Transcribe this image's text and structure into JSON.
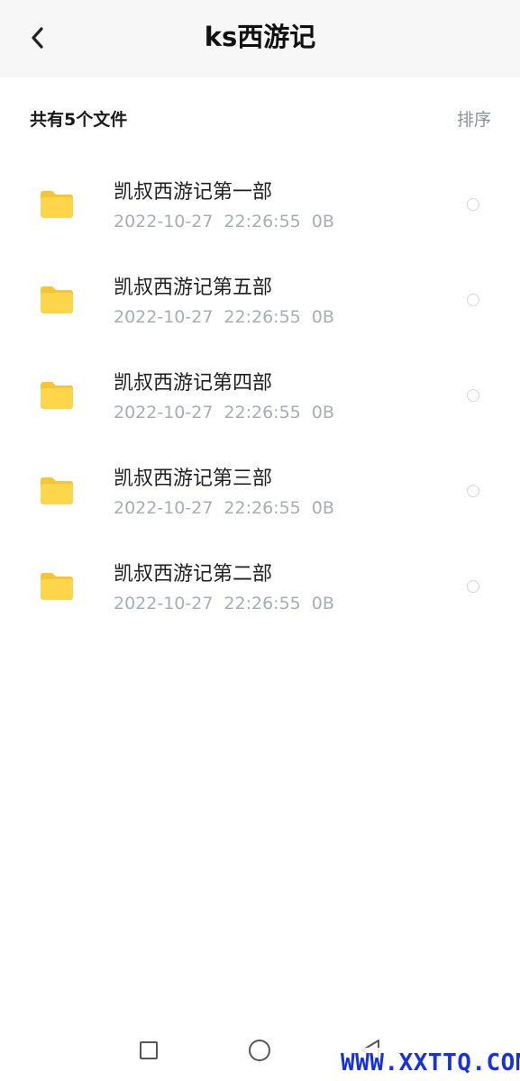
{
  "header": {
    "title": "ks西游记",
    "back_icon": "chevron-left-icon"
  },
  "summary": {
    "count_label": "共有5个文件",
    "sort_label": "排序"
  },
  "files": [
    {
      "name": "凯叔西游记第一部",
      "date": "2022-10-27",
      "time": "22:26:55",
      "size": "0B"
    },
    {
      "name": "凯叔西游记第五部",
      "date": "2022-10-27",
      "time": "22:26:55",
      "size": "0B"
    },
    {
      "name": "凯叔西游记第四部",
      "date": "2022-10-27",
      "time": "22:26:55",
      "size": "0B"
    },
    {
      "name": "凯叔西游记第三部",
      "date": "2022-10-27",
      "time": "22:26:55",
      "size": "0B"
    },
    {
      "name": "凯叔西游记第二部",
      "date": "2022-10-27",
      "time": "22:26:55",
      "size": "0B"
    }
  ],
  "navbar": {
    "icons": [
      "square-recents-icon",
      "circle-home-icon",
      "triangle-back-icon"
    ]
  },
  "watermark": {
    "text": "WWW.XXTTQ.COM"
  },
  "colors": {
    "folder": "#ffd54a",
    "folder_tab": "#f5c535",
    "header_bg": "#f7f7f7",
    "secondary_text": "#a7adb5",
    "watermark": "#1530e6"
  }
}
